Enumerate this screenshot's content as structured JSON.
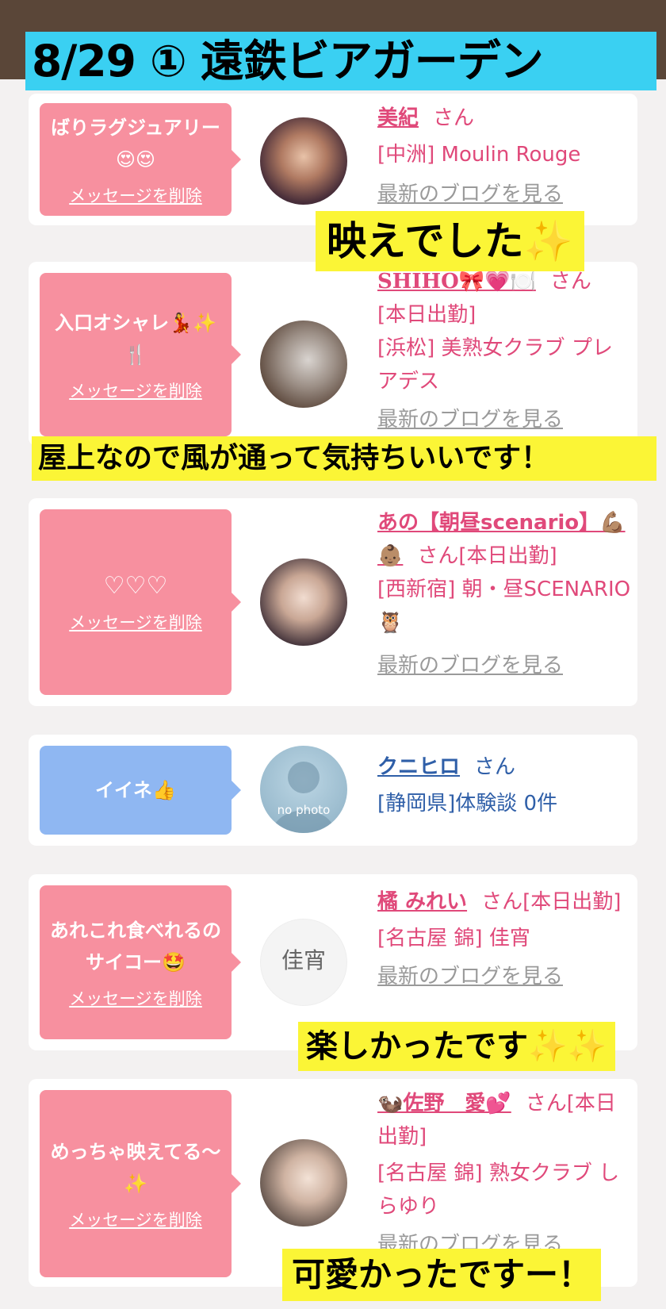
{
  "title": "8/29 ① 遠鉄ビアガーデン",
  "delete_label": "メッセージを削除",
  "blog_label": "最新のブログを見る",
  "san_label": "さん",
  "cards": [
    {
      "message": "ばりラグジュアリー😍😍",
      "name": "美紀",
      "line1": "[中洲] Moulin Rouge",
      "line2": ""
    },
    {
      "message": "入口オシャレ💃✨🍴",
      "name": "SHIHO🎀💗🍽️",
      "line1": "[本日出勤]",
      "line2": "[浜松] 美熟女クラブ プレアデス"
    },
    {
      "message": "♡♡♡",
      "name": "あの【朝昼scenario】💪🏽👶🏽",
      "line1": "[本日出勤]",
      "line2": "[西新宿] 朝・昼SCENARIO 🦉"
    },
    {
      "message": "イイネ👍",
      "name": "クニヒロ",
      "line1": "[静岡県]体験談 0件",
      "line2": "",
      "avatar_text": "no photo"
    },
    {
      "message": "あれこれ食べれるのサイコー🤩",
      "name": "橘 みれい",
      "line1": "[本日出勤]",
      "line2": "[名古屋 錦] 佳宵",
      "avatar_text": "佳宵"
    },
    {
      "message": "めっちゃ映えてる〜✨",
      "name": "🦦佐野　愛💕",
      "line1": "[本日出勤]",
      "line2": "[名古屋 錦] 熟女クラブ しらゆり"
    }
  ],
  "subtitles": [
    "映えでした✨",
    "屋上なので風が通って気持ちいいです！",
    "楽しかったです✨✨",
    "可愛かったですー！"
  ]
}
